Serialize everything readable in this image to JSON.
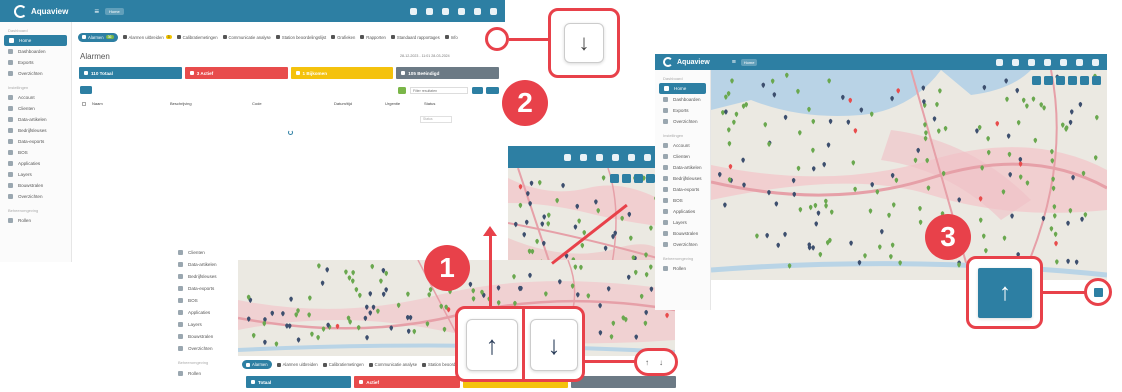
{
  "app": {
    "name": "Aquaview",
    "home_chip": "Home"
  },
  "sidebar_main": {
    "section_dashboard": "Dashboard",
    "items_top": [
      "Home",
      "Dashboarden",
      "Exports",
      "Overzichten"
    ],
    "section_instellingen": "Instellingen",
    "items_settings": [
      "Account",
      "Clienten",
      "Data-artikelen",
      "Bedrijfsleuses",
      "Data-exports",
      "BOS",
      "Applicaties",
      "Layers",
      "Bouwstralen",
      "Overzichten"
    ],
    "section_beheer": "Beheeromgeving",
    "items_beheer": [
      "Rollen"
    ]
  },
  "screen1": {
    "tabs": [
      {
        "label": "Alarmen",
        "badge": "36",
        "active": true
      },
      {
        "label": "Alarmen uitbreiden",
        "badge": "3",
        "active": false
      },
      {
        "label": "Calibratiemetingen",
        "active": false
      },
      {
        "label": "Communicatie analyse",
        "active": false
      },
      {
        "label": "Station beoordelingslijst",
        "active": false
      },
      {
        "label": "Grafieken",
        "active": false
      },
      {
        "label": "Rapporten",
        "active": false
      },
      {
        "label": "Standaard rapportages",
        "active": false
      },
      {
        "label": "Info",
        "active": false
      }
    ],
    "title": "Alarmen",
    "date": "28-12-2023 - 11:01 28-03-2024",
    "cards": [
      {
        "label": "110 Totaal",
        "color": "blue"
      },
      {
        "label": "3 Actief",
        "color": "red"
      },
      {
        "label": "1 Bijkomen",
        "color": "yellow"
      },
      {
        "label": "105 Beëindigd",
        "color": "grey"
      }
    ],
    "filter_placeholder": "Filter resultaten",
    "columns": [
      "Naam",
      "Beschrijving",
      "Code",
      "Datum/tijd",
      "Urgentie",
      "Status"
    ],
    "status_filter": "Status"
  },
  "screen_bottom": {
    "sidebar_items": [
      "Clienten",
      "Data-artikelen",
      "Bedrijfsleuses",
      "Data-exports",
      "BOS",
      "Applicaties",
      "Layers",
      "Bouwstralen",
      "Overzichten"
    ],
    "section_beheer": "Beheeromgeving",
    "item_rollen": "Rollen",
    "tabs": [
      "Alarmen",
      "Alarmen uitbreiden",
      "Calibratiemetingen",
      "Communicatie analyse",
      "Station beoordelingslijst",
      "Grafieken"
    ],
    "cards": [
      {
        "label": "Totaal",
        "color": "blue"
      },
      {
        "label": "Actief",
        "color": "red"
      },
      {
        "label": "",
        "color": "yellow"
      },
      {
        "label": "",
        "color": "grey"
      }
    ]
  },
  "screen3": {
    "sidebar_items": [
      "Home",
      "Dashboarden",
      "Exports",
      "Overzichten"
    ],
    "section_instellingen": "Instellingen",
    "settings_items": [
      "Account",
      "Clienten",
      "Data-artikelen",
      "Bedrijfsleuses",
      "Data-exports",
      "BOS",
      "Applicaties",
      "Layers",
      "Bouwstralen",
      "Overzichten"
    ],
    "section_beheer": "Beheeromgeving",
    "item_rollen": "Rollen"
  },
  "callouts": {
    "step1": "1",
    "step2": "2",
    "step3": "3",
    "up_arrow": "↑",
    "down_arrow": "↓"
  },
  "colors": {
    "brand": "#2d7fa3",
    "callout_red": "#e8414a",
    "green_pin": "#6aa84f",
    "navy_pin": "#3d4f6e",
    "red_pin": "#e84c4c"
  }
}
